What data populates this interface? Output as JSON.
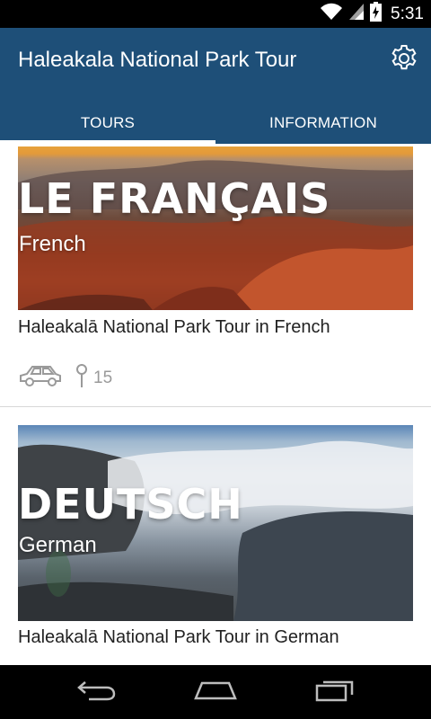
{
  "status_bar": {
    "time": "5:31",
    "icons": [
      "wifi-icon",
      "signal-icon",
      "battery-charging-icon"
    ]
  },
  "app_bar": {
    "title": "Haleakala National Park Tour",
    "settings_icon": "gear-icon"
  },
  "tabs": [
    {
      "label": "TOURS",
      "active": true
    },
    {
      "label": "INFORMATION",
      "active": false
    }
  ],
  "tours": [
    {
      "hero_title": "LE FRANÇAIS",
      "hero_subtitle": "French",
      "caption": "Haleakalā National Park Tour in French",
      "mode_icon": "car-icon",
      "stop_icon": "map-pin-icon",
      "stop_count": "15"
    },
    {
      "hero_title": "DEUTSCH",
      "hero_subtitle": "German",
      "caption": "Haleakalā National Park Tour in German"
    }
  ],
  "nav_bar": {
    "buttons": [
      "back-icon",
      "home-icon",
      "recent-apps-icon"
    ]
  },
  "colors": {
    "app_bar": "#1e4f78",
    "status_bar": "#000000",
    "nav_bar": "#000000"
  }
}
